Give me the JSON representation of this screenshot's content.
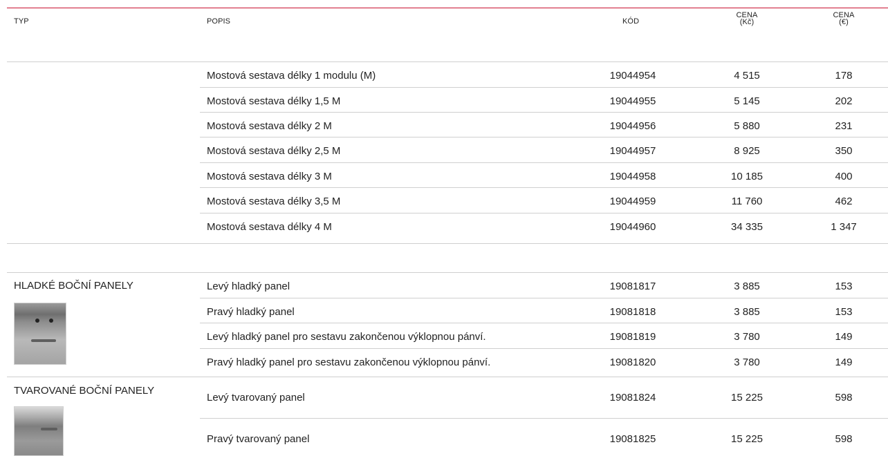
{
  "colors": {
    "accent": "#c8102e"
  },
  "header": {
    "typ": "TYP",
    "popis": "POPIS",
    "kod": "KÓD",
    "cena_czk": [
      "CENA",
      "(Kč)"
    ],
    "cena_eur": [
      "CENA",
      "(€)"
    ]
  },
  "bridge_rows": [
    {
      "desc": "Mostová sestava délky 1 modulu (M)",
      "code": "19044954",
      "czk": "4 515",
      "eur": "178"
    },
    {
      "desc": "Mostová sestava délky 1,5 M",
      "code": "19044955",
      "czk": "5 145",
      "eur": "202"
    },
    {
      "desc": "Mostová sestava délky 2 M",
      "code": "19044956",
      "czk": "5 880",
      "eur": "231"
    },
    {
      "desc": "Mostová sestava délky 2,5 M",
      "code": "19044957",
      "czk": "8 925",
      "eur": "350"
    },
    {
      "desc": "Mostová sestava délky 3 M",
      "code": "19044958",
      "czk": "10 185",
      "eur": "400"
    },
    {
      "desc": "Mostová sestava délky 3,5 M",
      "code": "19044959",
      "czk": "11 760",
      "eur": "462"
    },
    {
      "desc": "Mostová sestava délky 4 M",
      "code": "19044960",
      "czk": "34 335",
      "eur": "1 347"
    }
  ],
  "smooth_panels": {
    "title": "HLADKÉ BOČNÍ PANELY",
    "image_icon": "smooth-side-panel-photo-icon",
    "rows": [
      {
        "desc": "Levý hladký panel",
        "code": "19081817",
        "czk": "3 885",
        "eur": "153"
      },
      {
        "desc": "Pravý hladký panel",
        "code": "19081818",
        "czk": "3 885",
        "eur": "153"
      },
      {
        "desc": "Levý hladký panel pro sestavu zakončenou výklopnou pánví.",
        "code": "19081819",
        "czk": "3 780",
        "eur": "149"
      },
      {
        "desc": "Pravý hladký panel pro sestavu zakončenou výklopnou pánví.",
        "code": "19081820",
        "czk": "3 780",
        "eur": "149"
      }
    ]
  },
  "shaped_panels": {
    "title": "TVAROVANÉ BOČNÍ PANELY",
    "image_icon": "shaped-side-panel-photo-icon",
    "rows": [
      {
        "desc": "Levý tvarovaný panel",
        "code": "19081824",
        "czk": "15 225",
        "eur": "598"
      },
      {
        "desc": "Pravý tvarovaný panel",
        "code": "19081825",
        "czk": "15 225",
        "eur": "598"
      }
    ]
  }
}
